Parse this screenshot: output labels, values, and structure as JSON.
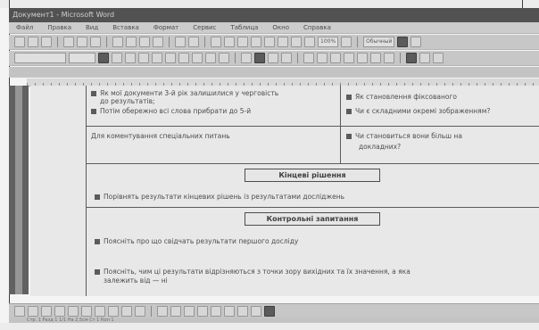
{
  "window": {
    "title": "Документ1 - Microsoft Word"
  },
  "menu": [
    "Файл",
    "Правка",
    "Вид",
    "Вставка",
    "Формат",
    "Сервис",
    "Таблица",
    "Окно",
    "Справка"
  ],
  "toolbar": {
    "zoom": "100%",
    "view": "Обычный"
  },
  "document": {
    "top_left_lines": [
      "Як мої документи 3-й рік залишилися у черговість",
      "до результатів;",
      "Потім обережно всі слова прибрати до 5-й"
    ],
    "top_right_lines": [
      "Як становлення фіксованого",
      "Чи є складними окремі зображенням?"
    ],
    "middle_left": "Для коментування спеціальних питань",
    "middle_right_lines": [
      "Чи становиться вони більш на",
      "докладних?"
    ],
    "section1_title": "Кінцеві рішення",
    "section1_item": "Порівнять результати кінцевих рішень із результатами досліджень",
    "section2_title": "Контрольні запитання",
    "section2_items": [
      "Поясніть про що свідчать результати першого досліду",
      "Поясніть, чим ці результати відрізняються з точки зору вихідних та їх значення, а яка",
      "залежить від — ні"
    ]
  },
  "statusbar": {
    "text": "Стр. 1   Разд 1   1/1   На 2,5см   Ст 1   Кол 1"
  }
}
